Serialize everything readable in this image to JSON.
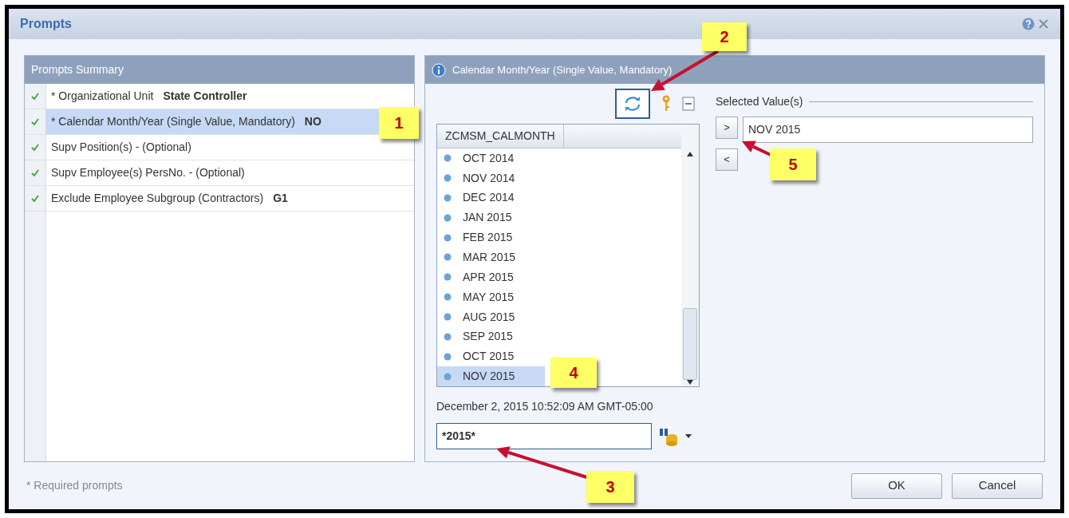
{
  "window": {
    "title": "Prompts"
  },
  "summary": {
    "title": "Prompts Summary",
    "items": [
      {
        "label": "* Organizational Unit",
        "value": "State Controller",
        "selected": false,
        "done": true
      },
      {
        "label": "* Calendar Month/Year (Single Value, Mandatory)",
        "value": "NO",
        "selected": true,
        "done": true
      },
      {
        "label": "Supv Position(s) - (Optional)",
        "selected": false,
        "done": true
      },
      {
        "label": "Supv Employee(s) PersNo. - (Optional)",
        "selected": false,
        "done": true
      },
      {
        "label": "Exclude Employee Subgroup (Contractors)",
        "value": "G1",
        "selected": false,
        "done": true
      }
    ]
  },
  "detail": {
    "title": "Calendar Month/Year (Single Value, Mandatory)",
    "column": "ZCMSM_CALMONTH",
    "items": [
      {
        "label": "OCT 2014",
        "selected": false
      },
      {
        "label": "NOV 2014",
        "selected": false
      },
      {
        "label": "DEC 2014",
        "selected": false
      },
      {
        "label": "JAN 2015",
        "selected": false
      },
      {
        "label": "FEB 2015",
        "selected": false
      },
      {
        "label": "MAR 2015",
        "selected": false
      },
      {
        "label": "APR 2015",
        "selected": false
      },
      {
        "label": "MAY 2015",
        "selected": false
      },
      {
        "label": "AUG 2015",
        "selected": false
      },
      {
        "label": "SEP 2015",
        "selected": false
      },
      {
        "label": "OCT 2015",
        "selected": false
      },
      {
        "label": "NOV 2015",
        "selected": true
      }
    ],
    "timestamp": "December 2, 2015 10:52:09 AM GMT-05:00",
    "search": {
      "value": "*2015*"
    },
    "selected_title": "Selected Value(s)",
    "selected_value": "NOV 2015",
    "move_buttons": [
      ">",
      "<"
    ]
  },
  "footer": {
    "note": "* Required prompts",
    "buttons": [
      "OK",
      "Cancel"
    ]
  },
  "callouts": [
    {
      "label": "1"
    },
    {
      "label": "2"
    },
    {
      "label": "3"
    },
    {
      "label": "4"
    },
    {
      "label": "5"
    }
  ]
}
